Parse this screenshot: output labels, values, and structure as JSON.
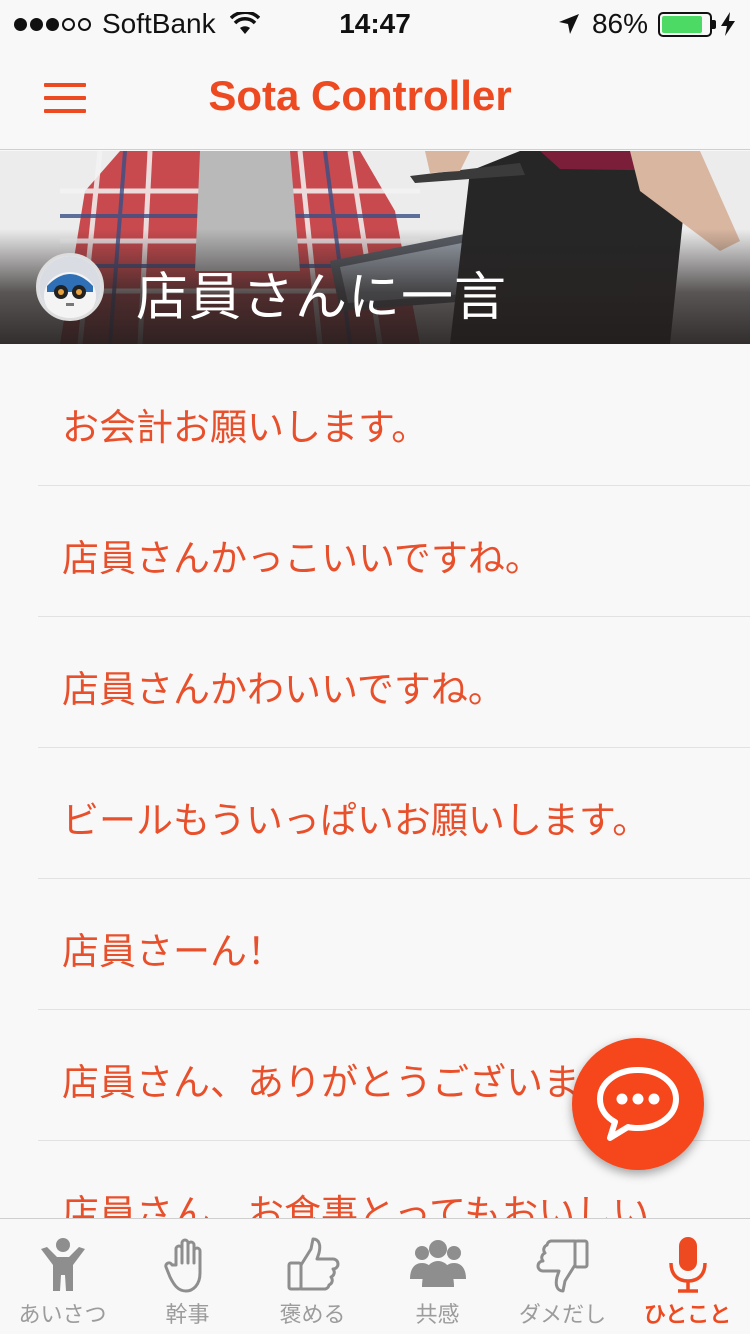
{
  "status_bar": {
    "carrier": "SoftBank",
    "time": "14:47",
    "battery_percent": "86%",
    "battery_level": 0.86,
    "signal_bars_on": 3,
    "signal_bars_total": 5
  },
  "nav": {
    "title": "Sota Controller",
    "menu_icon": "hamburger-menu-icon"
  },
  "banner": {
    "title": "店員さんに一言"
  },
  "list": {
    "items": [
      {
        "label": "お会計お願いします。"
      },
      {
        "label": "店員さんかっこいいですね。"
      },
      {
        "label": "店員さんかわいいですね。"
      },
      {
        "label": "ビールもういっぱいお願いします。"
      },
      {
        "label": "店員さーん！"
      },
      {
        "label": "店員さん、ありがとうございます。"
      },
      {
        "label": "店員さん、お食事とってもおいしい"
      }
    ]
  },
  "fab": {
    "icon": "speech-bubble-icon"
  },
  "tab_bar": {
    "tabs": [
      {
        "label": "あいさつ",
        "icon": "person-icon",
        "active": false
      },
      {
        "label": "幹事",
        "icon": "hand-icon",
        "active": false
      },
      {
        "label": "褒める",
        "icon": "thumbs-up-icon",
        "active": false
      },
      {
        "label": "共感",
        "icon": "group-icon",
        "active": false
      },
      {
        "label": "ダメだし",
        "icon": "thumbs-down-icon",
        "active": false
      },
      {
        "label": "ひとこと",
        "icon": "microphone-icon",
        "active": true
      }
    ]
  },
  "colors": {
    "accent": "#ee4a21",
    "list_text": "#e8502c",
    "inactive_tab": "#9c9c9c",
    "battery": "#4cd964"
  }
}
